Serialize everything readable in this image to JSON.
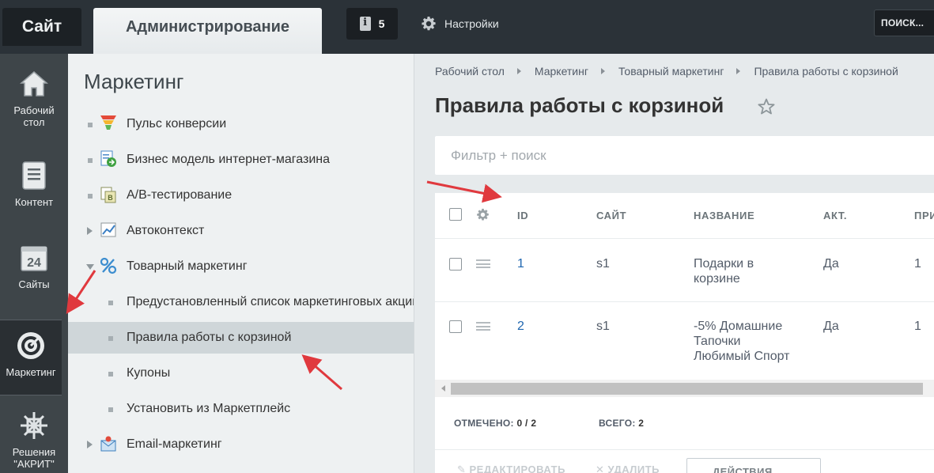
{
  "topbar": {
    "site_tab": "Сайт",
    "admin_tab": "Администрирование",
    "notifications_count": "5",
    "settings_label": "Настройки",
    "search_label": "ПОИСК..."
  },
  "rail": {
    "items": [
      {
        "label": "Рабочий стол",
        "icon": "home-icon"
      },
      {
        "label": "Контент",
        "icon": "document-icon"
      },
      {
        "label": "Сайты",
        "icon": "calendar-24-icon"
      },
      {
        "label": "Маркетинг",
        "icon": "target-icon",
        "active": true
      },
      {
        "label": "Решения \"АКРИТ\"",
        "icon": "knot-icon"
      }
    ]
  },
  "menu": {
    "title": "Маркетинг",
    "items": [
      {
        "label": "Пульс конверсии",
        "icon": "funnel-icon"
      },
      {
        "label": "Бизнес модель интернет-магазина",
        "icon": "business-model-icon"
      },
      {
        "label": "A/B-тестирование",
        "icon": "ab-test-icon"
      },
      {
        "label": "Автоконтекст",
        "icon": "chart-icon"
      },
      {
        "label": "Товарный маркетинг",
        "icon": "percent-icon"
      },
      {
        "label": "Предустановленный список маркетинговых акций"
      },
      {
        "label": "Правила работы с корзиной",
        "selected": true
      },
      {
        "label": "Купоны"
      },
      {
        "label": "Установить из Маркетплейс"
      },
      {
        "label": "Email-маркетинг",
        "icon": "email-icon"
      }
    ]
  },
  "breadcrumb": [
    "Рабочий стол",
    "Маркетинг",
    "Товарный маркетинг",
    "Правила работы с корзиной"
  ],
  "page_title": "Правила работы с корзиной",
  "filter": {
    "placeholder": "Фильтр + поиск"
  },
  "table": {
    "columns": [
      "ID",
      "САЙТ",
      "НАЗВАНИЕ",
      "АКТ.",
      "ПРИ"
    ],
    "rows": [
      {
        "id": "1",
        "site": "s1",
        "name_lines": [
          "Подарки в",
          "корзине"
        ],
        "active": "Да",
        "priority": "1"
      },
      {
        "id": "2",
        "site": "s1",
        "name_lines": [
          "-5% Домашние",
          "Тапочки",
          "Любимый Спорт"
        ],
        "active": "Да",
        "priority": "1"
      }
    ]
  },
  "footer": {
    "marked_label": "ОТМЕЧЕНО:",
    "marked_value": "0 / 2",
    "total_label": "ВСЕГО:",
    "total_value": "2"
  },
  "actions": {
    "edit": "РЕДАКТИРОВАТЬ",
    "delete": "УДАЛИТЬ",
    "select": "ДЕЙСТВИЯ"
  },
  "colors": {
    "topbar": "#2b3238",
    "rail": "#3e4549",
    "menu_bg": "#eef1f2",
    "link": "#2067b0",
    "annotation": "#e0393e"
  }
}
